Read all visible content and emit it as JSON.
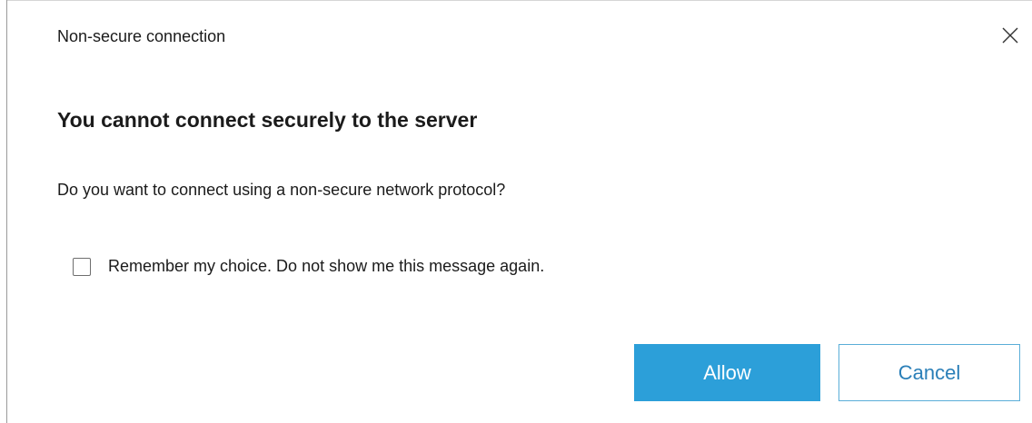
{
  "dialog": {
    "title": "Non-secure connection",
    "close_icon": "close-icon",
    "heading": "You cannot connect securely to the server",
    "question": "Do you want to connect using a non-secure network protocol?",
    "remember_checkbox": {
      "label": "Remember my choice. Do not show me this message again.",
      "checked": false
    },
    "buttons": {
      "allow_label": "Allow",
      "cancel_label": "Cancel"
    }
  },
  "colors": {
    "primary": "#2c9fd9",
    "cancel_text": "#2a7fb8",
    "text": "#1b1b1b"
  }
}
